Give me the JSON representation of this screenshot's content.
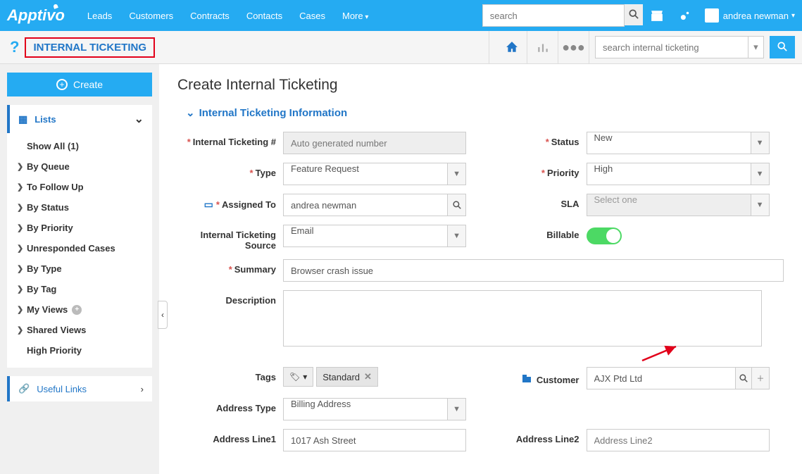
{
  "topnav": {
    "logo": "Apptivo",
    "items": [
      "Leads",
      "Customers",
      "Contracts",
      "Contacts",
      "Cases"
    ],
    "more": "More",
    "search_placeholder": "search",
    "user": "andrea newman"
  },
  "subheader": {
    "app_title": "INTERNAL TICKETING",
    "search_placeholder": "search internal ticketing"
  },
  "sidebar": {
    "create": "Create",
    "lists_label": "Lists",
    "items": [
      {
        "label": "Show All (1)",
        "caret": false
      },
      {
        "label": "By Queue",
        "caret": true
      },
      {
        "label": "To Follow Up",
        "caret": true
      },
      {
        "label": "By Status",
        "caret": true
      },
      {
        "label": "By Priority",
        "caret": true
      },
      {
        "label": "Unresponded Cases",
        "caret": true
      },
      {
        "label": "By Type",
        "caret": true
      },
      {
        "label": "By Tag",
        "caret": true
      },
      {
        "label": "My Views",
        "caret": true,
        "add": true
      },
      {
        "label": "Shared Views",
        "caret": true
      },
      {
        "label": "High Priority",
        "caret": false
      }
    ],
    "useful_links": "Useful Links"
  },
  "form": {
    "title": "Create Internal Ticketing",
    "section": "Internal Ticketing Information",
    "ticket_num_label": "Internal Ticketing #",
    "ticket_num_value": "Auto generated number",
    "status_label": "Status",
    "status_value": "New",
    "type_label": "Type",
    "type_value": "Feature Request",
    "priority_label": "Priority",
    "priority_value": "High",
    "assigned_label": "Assigned To",
    "assigned_value": "andrea newman",
    "sla_label": "SLA",
    "sla_placeholder": "Select one",
    "source_label": "Internal Ticketing Source",
    "source_value": "Email",
    "billable_label": "Billable",
    "summary_label": "Summary",
    "summary_value": "Browser crash issue",
    "description_label": "Description",
    "description_value": "",
    "tags_label": "Tags",
    "tag_chip": "Standard",
    "customer_label": "Customer",
    "customer_value": "AJX Ptd Ltd",
    "address_type_label": "Address Type",
    "address_type_value": "Billing Address",
    "address1_label": "Address Line1",
    "address1_value": "1017 Ash Street",
    "address2_label": "Address Line2",
    "address2_placeholder": "Address Line2"
  }
}
